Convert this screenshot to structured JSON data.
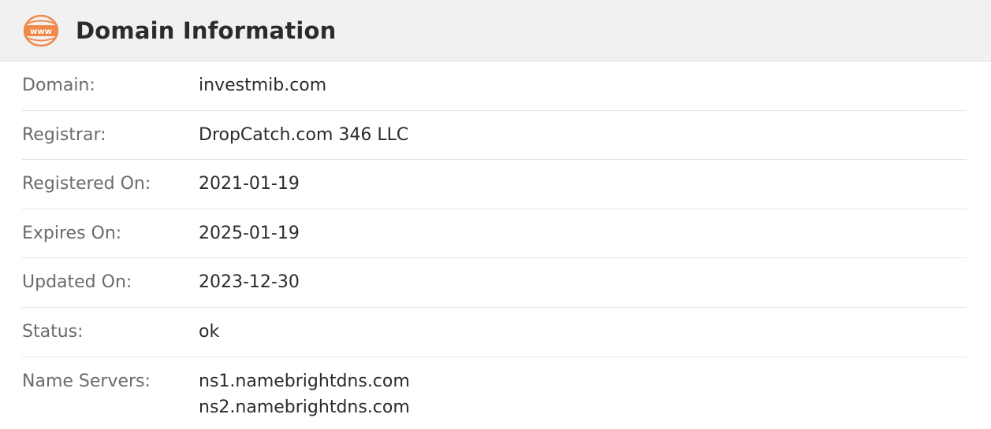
{
  "header": {
    "title": "Domain Information",
    "icon": "www-icon",
    "icon_text": "www",
    "accent_color": "#f08a4b"
  },
  "rows": [
    {
      "label": "Domain:",
      "value": "investmib.com"
    },
    {
      "label": "Registrar:",
      "value": "DropCatch.com 346 LLC"
    },
    {
      "label": "Registered On:",
      "value": "2021-01-19"
    },
    {
      "label": "Expires On:",
      "value": "2025-01-19"
    },
    {
      "label": "Updated On:",
      "value": "2023-12-30"
    },
    {
      "label": "Status:",
      "value": "ok"
    }
  ],
  "name_servers": {
    "label": "Name Servers:",
    "values": [
      "ns1.namebrightdns.com",
      "ns2.namebrightdns.com"
    ]
  }
}
